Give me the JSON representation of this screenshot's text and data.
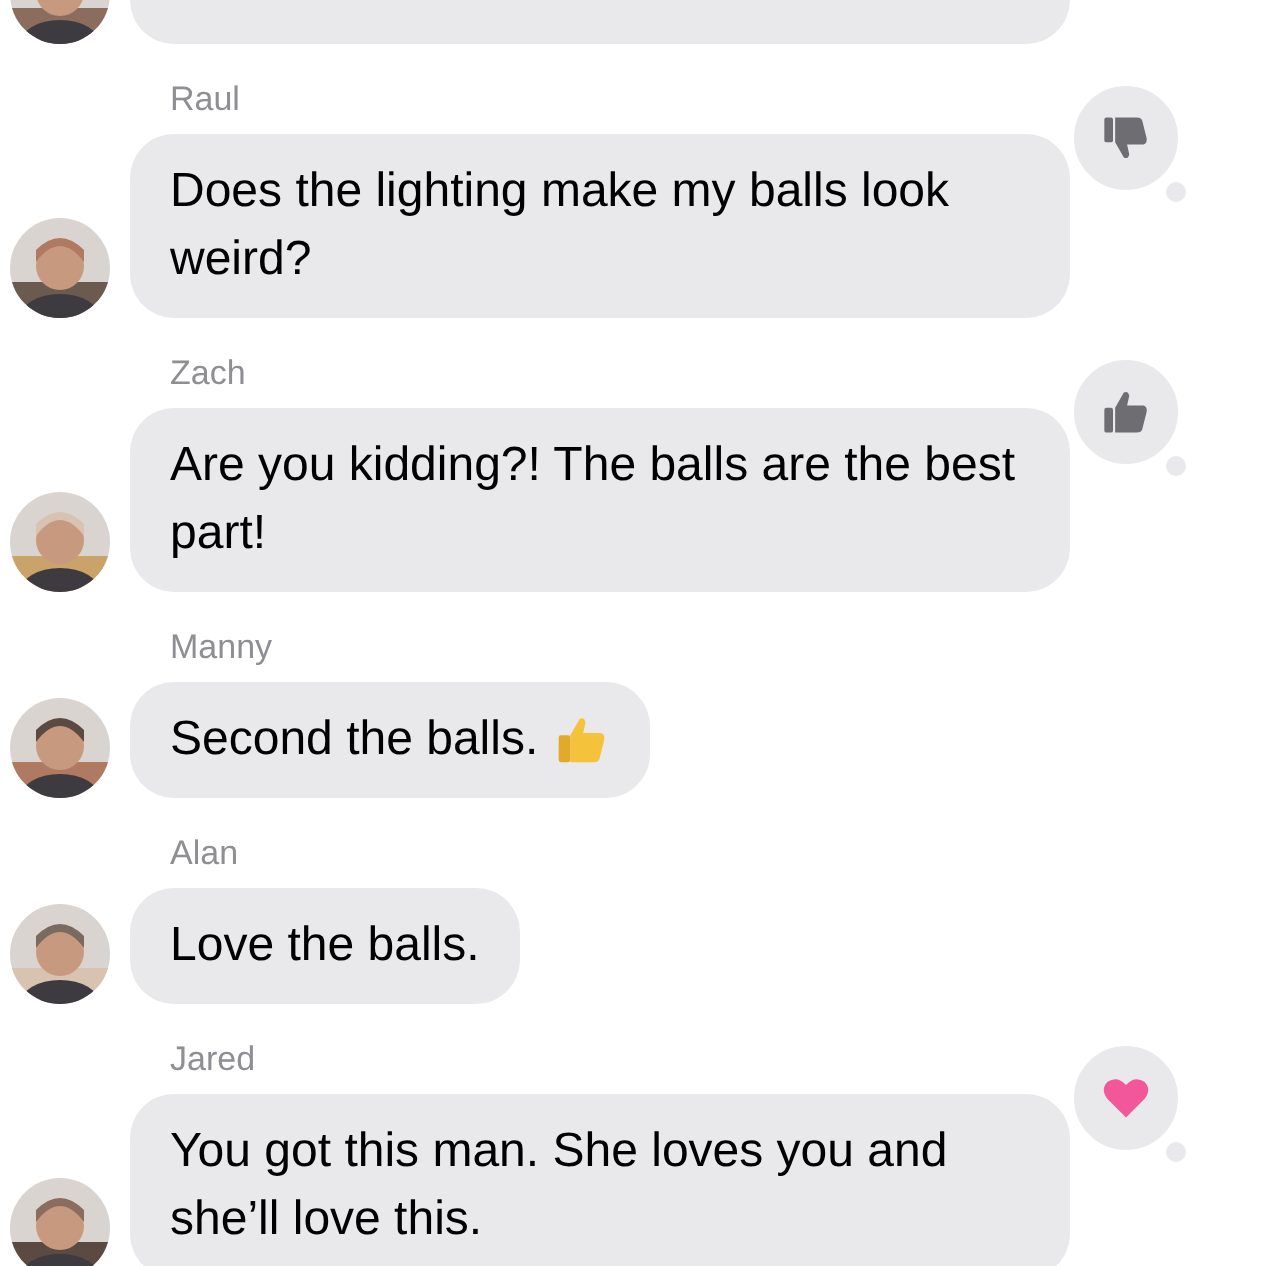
{
  "messages": [
    {
      "kind": "cut"
    },
    {
      "kind": "text",
      "sender": "Raul",
      "text": "Does the lighting make my balls look weird?",
      "reaction": {
        "kind": "thumbs_down"
      }
    },
    {
      "kind": "text",
      "sender": "Zach",
      "text": "Are you kidding?! The balls are the best part!",
      "reaction": {
        "kind": "thumbs_up"
      }
    },
    {
      "kind": "text",
      "sender": "Manny",
      "text": "Second the balls.",
      "emoji": {
        "kind": "thumbs_up"
      }
    },
    {
      "kind": "text",
      "sender": "Alan",
      "text": "Love the balls."
    },
    {
      "kind": "text",
      "sender": "Jared",
      "text": "You got this man. She loves you and she’ll love this.",
      "reaction": {
        "kind": "heart"
      }
    }
  ]
}
